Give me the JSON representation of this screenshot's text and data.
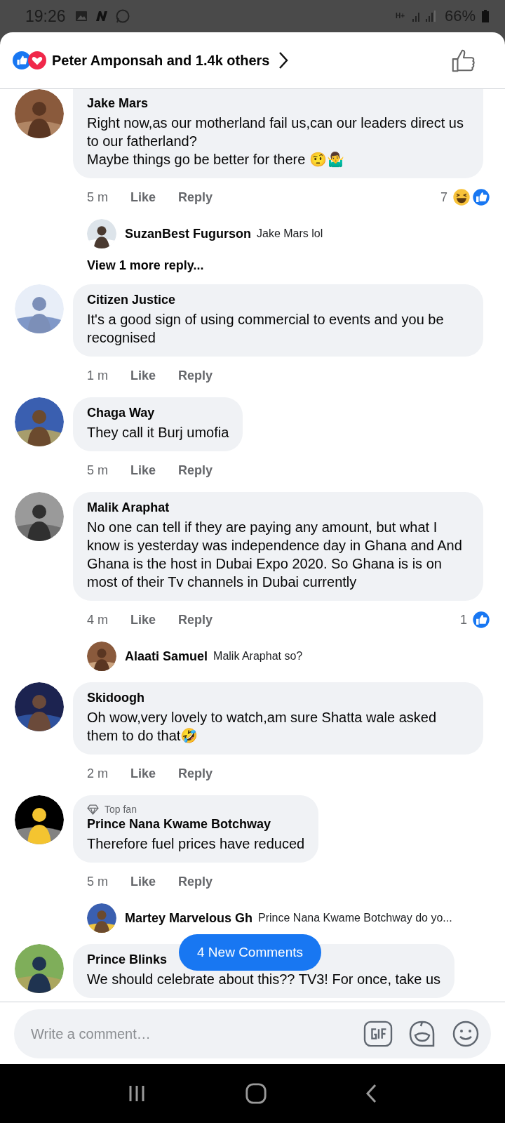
{
  "status_bar": {
    "time": "19:26",
    "network_type": "H+",
    "battery": "66%"
  },
  "header": {
    "reactors": "Peter Amponsah and 1.4k others"
  },
  "comments": [
    {
      "name": "Jake Mars",
      "top_fan": false,
      "text": "Right now,as our motherland fail us,can our leaders direct us to our fatherland?\nMaybe things go be better for there 🤨🤷‍♂️",
      "time": "5 m",
      "like": "Like",
      "reply": "Reply",
      "reaction_count": "7",
      "reactions": [
        {
          "kind": "haha"
        },
        {
          "kind": "like"
        }
      ],
      "replies": [
        {
          "name": "SuzanBest Fugurson",
          "text": "Jake Mars lol"
        }
      ],
      "more_replies": "View 1 more reply..."
    },
    {
      "name": "Citizen Justice",
      "top_fan": false,
      "text": "It's a good sign of using commercial to events and you be recognised",
      "time": "1 m",
      "like": "Like",
      "reply": "Reply"
    },
    {
      "name": "Chaga Way",
      "top_fan": false,
      "text": "They call it Burj umofia",
      "time": "5 m",
      "like": "Like",
      "reply": "Reply"
    },
    {
      "name": "Malik Araphat",
      "top_fan": false,
      "text": "No one can tell if they are paying any amount, but what I know is yesterday was independence day in Ghana and And Ghana is the host in Dubai Expo 2020. So Ghana is is on most of their Tv channels in Dubai currently",
      "time": "4 m",
      "like": "Like",
      "reply": "Reply",
      "reaction_count": "1",
      "reactions": [
        {
          "kind": "like"
        }
      ],
      "replies": [
        {
          "name": "Alaati Samuel",
          "text": "Malik Araphat so?"
        }
      ]
    },
    {
      "name": "Skidoogh",
      "top_fan": false,
      "text": "Oh wow,very lovely to watch,am sure Shatta wale asked them to do that🤣",
      "time": "2 m",
      "like": "Like",
      "reply": "Reply"
    },
    {
      "name": "Prince Nana Kwame Botchway",
      "top_fan": true,
      "badge": "Top fan",
      "text": "Therefore fuel prices have reduced",
      "time": "5 m",
      "like": "Like",
      "reply": "Reply",
      "replies": [
        {
          "name": "Martey Marvelous Gh",
          "text": "Prince Nana Kwame Botchway do yo..."
        }
      ]
    },
    {
      "name": "Prince Blinks",
      "top_fan": false,
      "text": "We should celebrate about this?? TV3! For once, take us"
    }
  ],
  "new_comments_button": "4 New Comments",
  "composer": {
    "placeholder": "Write a comment…"
  }
}
